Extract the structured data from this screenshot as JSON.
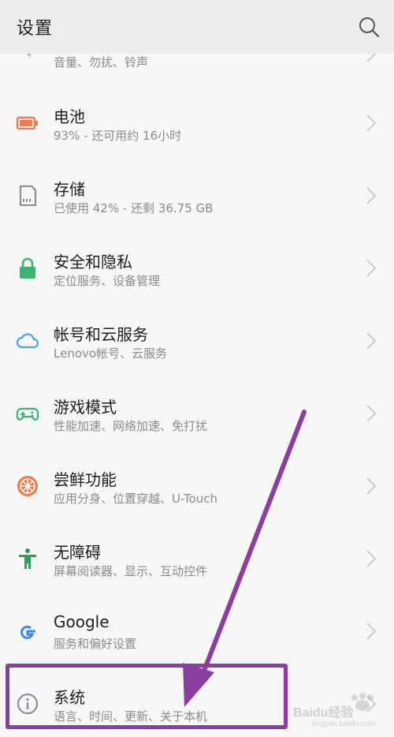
{
  "header": {
    "title": "设置",
    "search_icon": "search-icon"
  },
  "items": [
    {
      "id": "sound",
      "title": "",
      "subtitle": "音量、勿扰、铃声",
      "icon": "volume-icon",
      "color": "#9aa0a6"
    },
    {
      "id": "battery",
      "title": "电池",
      "subtitle": "93% - 还可用约 16小时",
      "icon": "battery-icon",
      "color": "#f07a4a"
    },
    {
      "id": "storage",
      "title": "存储",
      "subtitle": "已使用 42% - 还剩 36.75 GB",
      "icon": "storage-icon",
      "color": "#8a8f98"
    },
    {
      "id": "security",
      "title": "安全和隐私",
      "subtitle": "定位服务、设备管理",
      "icon": "lock-icon",
      "color": "#3cb371"
    },
    {
      "id": "account",
      "title": "帐号和云服务",
      "subtitle": "Lenovo帐号、云服务",
      "icon": "cloud-icon",
      "color": "#4aa3df"
    },
    {
      "id": "game",
      "title": "游戏模式",
      "subtitle": "性能加速、网络加速、免打扰",
      "icon": "gamepad-icon",
      "color": "#3cb371"
    },
    {
      "id": "labs",
      "title": "尝鲜功能",
      "subtitle": "应用分身、位置穿越、U-Touch",
      "icon": "orange-slice-icon",
      "color": "#f07a4a"
    },
    {
      "id": "accessibility",
      "title": "无障碍",
      "subtitle": "屏幕阅读器、显示、互动控件",
      "icon": "accessibility-icon",
      "color": "#2e9e5b"
    },
    {
      "id": "google",
      "title": "Google",
      "subtitle": "服务和偏好设置",
      "icon": "google-icon",
      "color": "#4285f4"
    },
    {
      "id": "system",
      "title": "系统",
      "subtitle": "语言、时间、更新、关于本机",
      "icon": "info-icon",
      "color": "#8a8f98"
    }
  ],
  "annotation": {
    "highlight_color": "#8a3fa0"
  },
  "watermark": {
    "brand": "Baidu经验",
    "site": "jingyan.baidu.com"
  }
}
